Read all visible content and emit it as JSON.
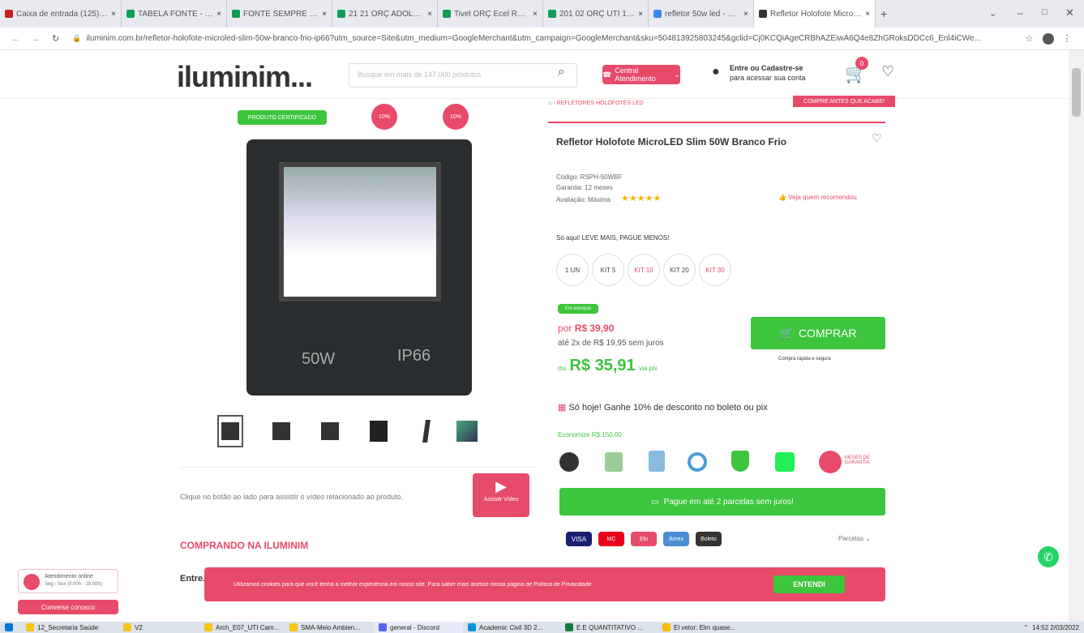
{
  "browser": {
    "tabs": [
      {
        "label": "Caixa de entrada (125) - ...",
        "color": "#c5221f"
      },
      {
        "label": "TABELA FONTE - Google ...",
        "color": "#0f9d58"
      },
      {
        "label": "FONTE SEMPRE ZT SIN...",
        "color": "#0f9d58"
      },
      {
        "label": "21 21 ORÇ ADOLFO Cal...",
        "color": "#0f9d58"
      },
      {
        "label": "Tivel ORÇ Ecel Reformas ...",
        "color": "#0f9d58"
      },
      {
        "label": "201 02 ORÇ UTI 14-01...",
        "color": "#0f9d58"
      },
      {
        "label": "refletor 50w led - Pesqui...",
        "color": "#4285f4"
      },
      {
        "label": "Refletor Holofote MicroL...",
        "color": "#333333"
      }
    ],
    "url": "iluminim.com.br/refletor-holofote-microled-slim-50w-branco-frio-ip66?utm_source=Site&utm_medium=GoogleMerchant&utm_campaign=GoogleMerchant&sku=504813925803245&gclid=Cj0KCQiAgeCRBhAZEiwA6Q4e8ZhGRoksDDCc6_Enl4iCWe..."
  },
  "header": {
    "logo": "iluminim...",
    "search_placeholder": "Busque em mais de 147.000 produtos",
    "support_label": "Central Atendimento",
    "login_line1": "Entre ou Cadastre-se",
    "login_line2": "para acessar sua conta",
    "cart_count": "0"
  },
  "gallery": {
    "certified_badge": "PRODUTO CERTIFICADO",
    "badge_1": "10%",
    "badge_2": "10%",
    "product_label_1": "50W",
    "product_label_2": "IP66",
    "video_hint": "Clique no botão ao lado para assistir o vídeo relacionado ao produto.",
    "video_button": "Assistir Vídeo"
  },
  "product": {
    "breadcrumb": "REFLETORES HOLOFOTES LED",
    "banner": "COMPRE ANTES QUE ACABE!",
    "title": "Refletor Holofote MicroLED Slim 50W Branco Frio",
    "code_line": "Código: RSPH-50WBF",
    "warranty_line": "Garantia: 12 meses",
    "rating_label": "Avaliação: Máxima",
    "rating_stars": "★★★★★",
    "recommend": "Veja quem recomendou",
    "promo_line": "Só aqui! LEVE MAIS, PAGUE MENOS!",
    "kits": [
      "1 UN",
      "KIT 5",
      "KIT 10",
      "KIT 20",
      "KIT 30"
    ],
    "stock_badge": "Em estoque",
    "price_prefix": "por",
    "price": "R$ 39,90",
    "installments": "até 2x de R$ 19,95 sem juros",
    "pix_prefix": "ou",
    "pix_price": "R$ 35,91",
    "pix_suffix": "via pix",
    "buy_button": "COMPRAR",
    "buy_note": "Compra rápida e segura",
    "boleto_promo": "Só hoje! Ganhe 10% de desconto no boleto ou pix",
    "savings": "Economize R$ 150,00",
    "guarantee_label": "MESES DE GARANTIA",
    "pay_banner": "Pague em até 2 parcelas sem juros!",
    "installments_link": "Parcelas",
    "pay_methods": [
      "VISA",
      "MC",
      "Elo",
      "Amex",
      "Boleto"
    ]
  },
  "section": {
    "buying_title": "COMPRANDO NA ILUMINIM",
    "entrega_title": "Entre..."
  },
  "support": {
    "chat_line1": "Atendimento online",
    "chat_line2": "Seg - Sex (8:00h - 18:00h)",
    "chat_button": "Converse conosco"
  },
  "cookie": {
    "text": "Utilizamos cookies para que você tenha a melhor experiência em nosso site. Para saber mais acesse nossa página de Política de Privacidade",
    "button": "ENTENDI"
  },
  "taskbar": {
    "items": [
      "12_Secretaria Saúde",
      "V2",
      "Arch_E07_UTI Cam...",
      "SMA-Meio Ambien...",
      "general - Discord",
      "Academic Civil 3D 2...",
      "E.E QUANTITATIVO ...",
      "El vetor: Elm quase..."
    ],
    "time": "14:52",
    "date": "2/03/2022"
  },
  "colors": {
    "brand_red": "#e84a6a",
    "green": "#3dc53d",
    "whatsapp": "#25d366"
  }
}
